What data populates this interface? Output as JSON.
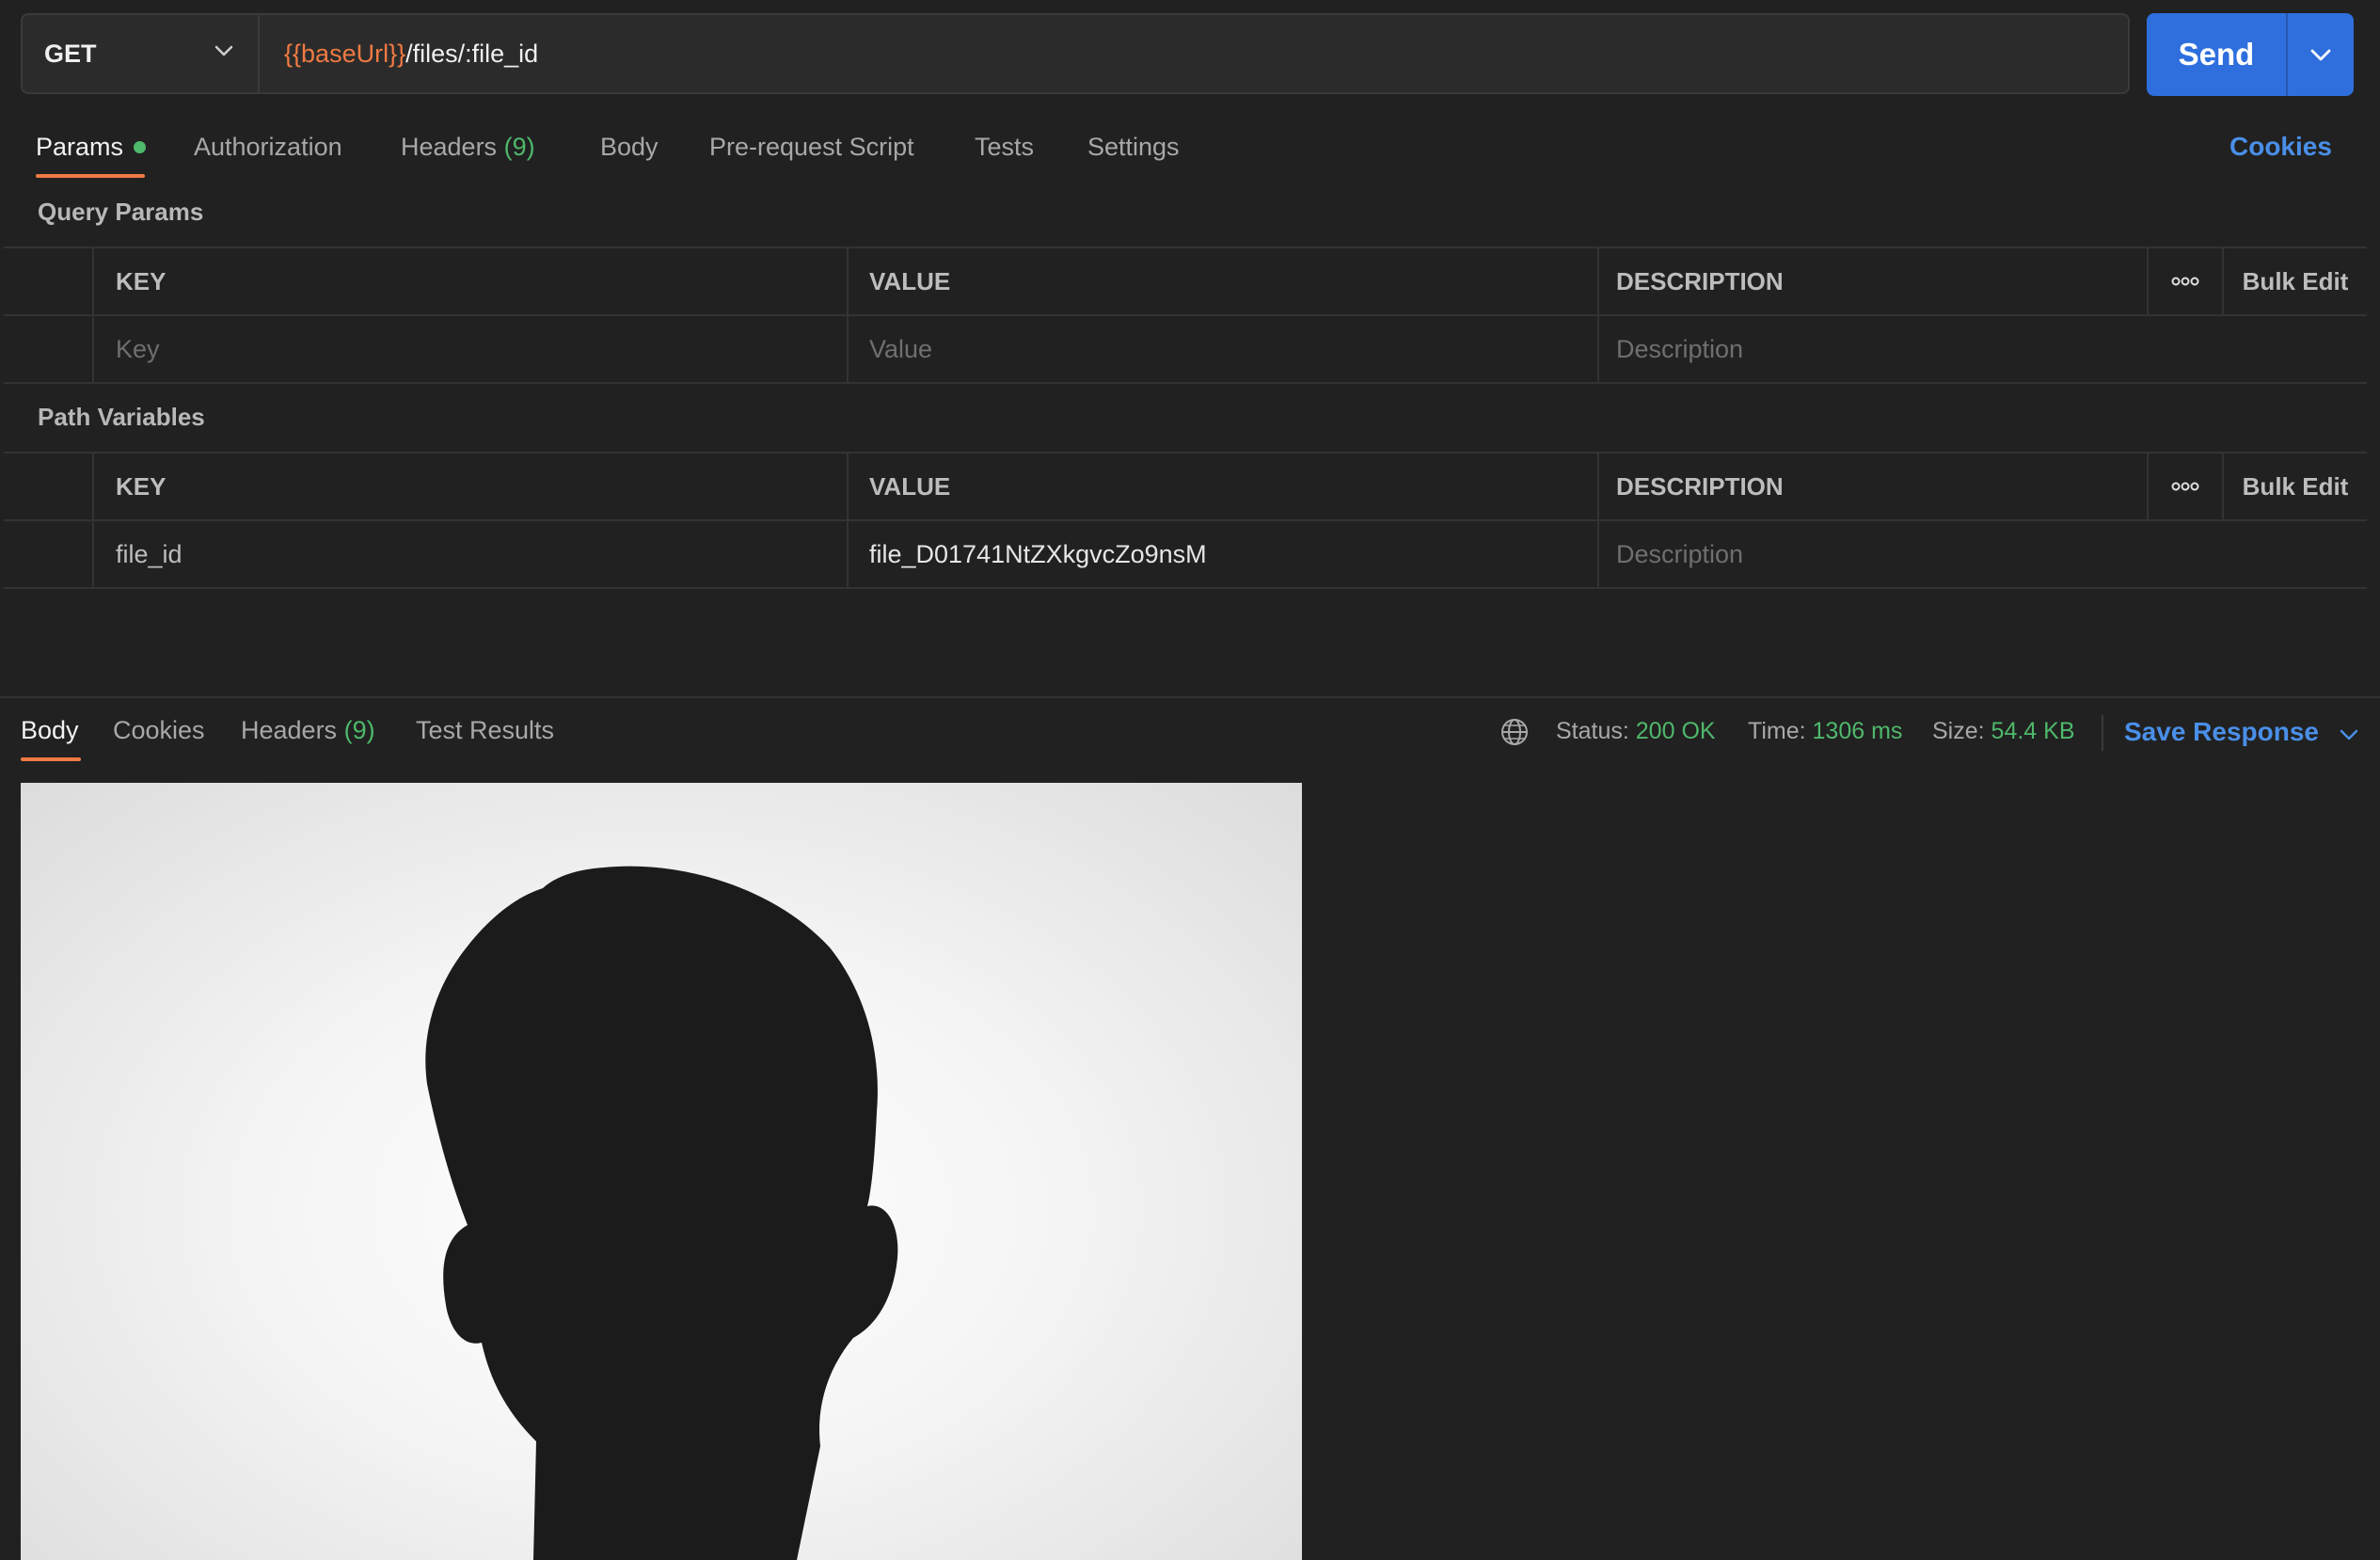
{
  "request": {
    "method": "GET",
    "url_var": "{{baseUrl}}",
    "url_path": "/files/:file_id",
    "send_label": "Send"
  },
  "request_tabs": {
    "params": "Params",
    "authorization": "Authorization",
    "headers": "Headers",
    "headers_count": "(9)",
    "body": "Body",
    "prerequest": "Pre-request Script",
    "tests": "Tests",
    "settings": "Settings",
    "cookies": "Cookies"
  },
  "query_params": {
    "title": "Query Params",
    "columns": {
      "key": "KEY",
      "value": "VALUE",
      "description": "DESCRIPTION"
    },
    "bulk_edit": "Bulk Edit",
    "placeholders": {
      "key": "Key",
      "value": "Value",
      "description": "Description"
    }
  },
  "path_variables": {
    "title": "Path Variables",
    "columns": {
      "key": "KEY",
      "value": "VALUE",
      "description": "DESCRIPTION"
    },
    "bulk_edit": "Bulk Edit",
    "rows": [
      {
        "key": "file_id",
        "value": "file_D01741NtZXkgvcZo9nsM",
        "description_placeholder": "Description"
      }
    ]
  },
  "response": {
    "tabs": {
      "body": "Body",
      "cookies": "Cookies",
      "headers": "Headers",
      "headers_count": "(9)",
      "test_results": "Test Results"
    },
    "status_label": "Status:",
    "status_value": "200 OK",
    "time_label": "Time:",
    "time_value": "1306 ms",
    "size_label": "Size:",
    "size_value": "54.4 KB",
    "save_response": "Save Response"
  },
  "colors": {
    "accent_orange": "#f07a43",
    "send_blue": "#2f6fdd",
    "link_blue": "#4a8fe8",
    "success_green": "#4fb86b",
    "background": "#212121"
  },
  "icons": [
    "chevron-down-icon",
    "globe-icon",
    "more-options-icon"
  ]
}
